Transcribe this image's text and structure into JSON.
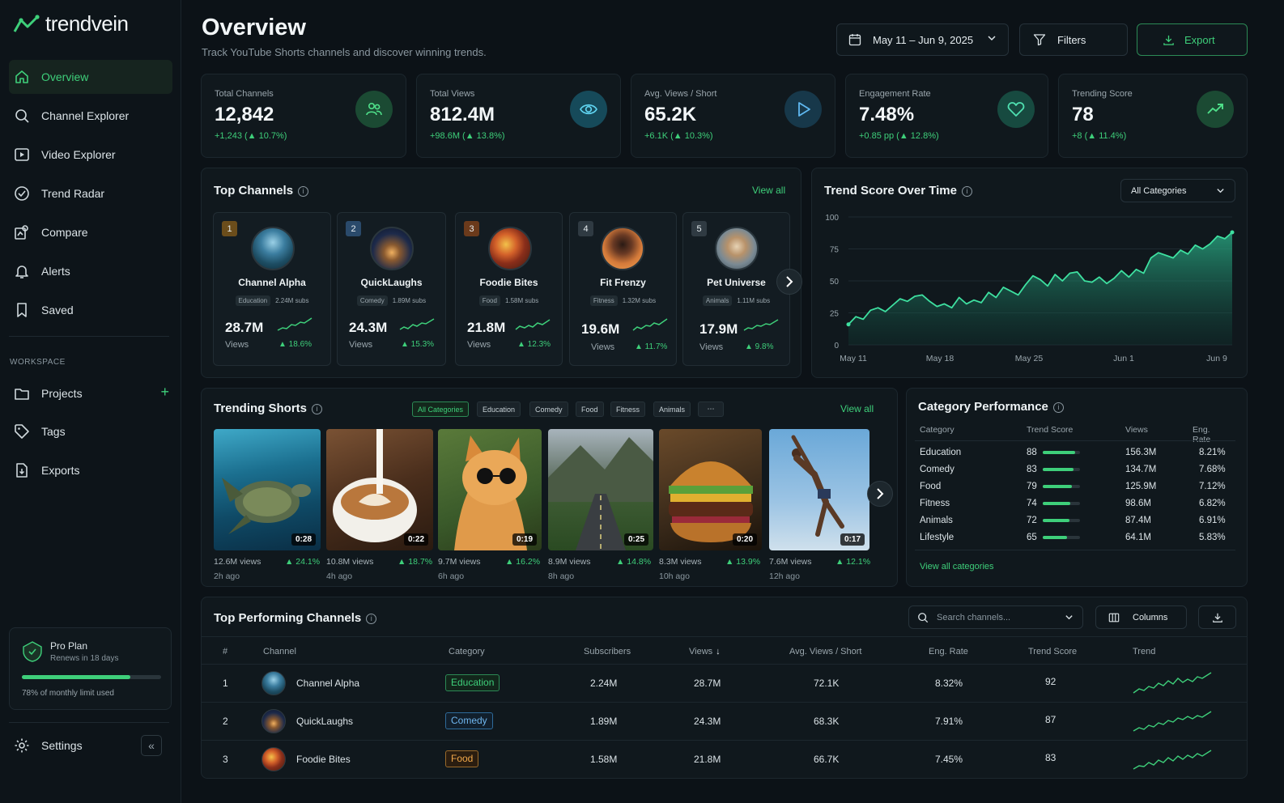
{
  "app": {
    "brand": "trendvein"
  },
  "nav": {
    "items": [
      {
        "label": "Overview"
      },
      {
        "label": "Channel Explorer"
      },
      {
        "label": "Video Explorer"
      },
      {
        "label": "Trend Radar"
      },
      {
        "label": "Compare"
      },
      {
        "label": "Alerts"
      },
      {
        "label": "Saved"
      }
    ],
    "workspace_label": "WORKSPACE",
    "workspace_items": [
      {
        "label": "Projects"
      },
      {
        "label": "Tags"
      },
      {
        "label": "Exports"
      }
    ],
    "settings_label": "Settings"
  },
  "plan": {
    "name": "Pro Plan",
    "renews": "Renews in 18 days",
    "usage_text": "78% of monthly limit used",
    "usage_fraction": 0.78
  },
  "header": {
    "title": "Overview",
    "subtitle": "Track YouTube Shorts channels and discover winning trends.",
    "date_range": "May 11 – Jun 9, 2025",
    "filters_label": "Filters",
    "export_label": "Export"
  },
  "stats": [
    {
      "label": "Total Channels",
      "value": "12,842",
      "delta": "+1,243 (▲ 10.7%)",
      "icon": "users-icon"
    },
    {
      "label": "Total Views",
      "value": "812.4M",
      "delta": "+98.6M (▲ 13.8%)",
      "icon": "eye-icon"
    },
    {
      "label": "Avg. Views / Short",
      "value": "65.2K",
      "delta": "+6.1K (▲ 10.3%)",
      "icon": "play-icon"
    },
    {
      "label": "Engagement Rate",
      "value": "7.48%",
      "delta": "+0.85 pp (▲ 12.8%)",
      "icon": "heart-icon"
    },
    {
      "label": "Trending Score",
      "value": "78",
      "delta": "+8 (▲ 11.4%)",
      "icon": "trending-up-icon"
    }
  ],
  "top_channels": {
    "title": "Top Channels",
    "view_all": "View all",
    "channels": [
      {
        "rank": "1",
        "name": "Channel Alpha",
        "category": "Education",
        "subs": "2.24M subs",
        "views": "28.7M",
        "views_label": "Views",
        "growth": "▲ 18.6%"
      },
      {
        "rank": "2",
        "name": "QuickLaughs",
        "category": "Comedy",
        "subs": "1.89M subs",
        "views": "24.3M",
        "views_label": "Views",
        "growth": "▲ 15.3%"
      },
      {
        "rank": "3",
        "name": "Foodie Bites",
        "category": "Food",
        "subs": "1.58M subs",
        "views": "21.8M",
        "views_label": "Views",
        "growth": "▲ 12.3%"
      },
      {
        "rank": "4",
        "name": "Fit Frenzy",
        "category": "Fitness",
        "subs": "1.32M subs",
        "views": "19.6M",
        "views_label": "Views",
        "growth": "▲ 11.7%"
      },
      {
        "rank": "5",
        "name": "Pet Universe",
        "category": "Animals",
        "subs": "1.11M subs",
        "views": "17.9M",
        "views_label": "Views",
        "growth": "▲ 9.8%"
      }
    ]
  },
  "trend_chart": {
    "title": "Trend Score Over Time",
    "dropdown": "All Categories"
  },
  "chart_data": {
    "type": "area",
    "title": "Trend Score Over Time",
    "x_ticks": [
      "May 11",
      "May 18",
      "May 25",
      "Jun 1",
      "Jun 9"
    ],
    "y_ticks": [
      "0",
      "25",
      "50",
      "75",
      "100"
    ],
    "ylim": [
      0,
      100
    ],
    "grid": true,
    "values": [
      16,
      22,
      20,
      27,
      29,
      26,
      31,
      36,
      34,
      38,
      39,
      34,
      30,
      32,
      29,
      37,
      32,
      35,
      33,
      41,
      37,
      45,
      42,
      39,
      47,
      54,
      51,
      46,
      55,
      50,
      56,
      57,
      50,
      49,
      53,
      48,
      52,
      58,
      53,
      59,
      56,
      68,
      72,
      70,
      68,
      74,
      71,
      78,
      75,
      79,
      85,
      83,
      88
    ]
  },
  "trending_shorts": {
    "title": "Trending Shorts",
    "view_all": "View all",
    "filters": [
      "All Categories",
      "Education",
      "Comedy",
      "Food",
      "Fitness",
      "Animals",
      "⋯"
    ],
    "items": [
      {
        "duration": "0:28",
        "views": "12.6M views",
        "growth": "▲ 24.1%",
        "age": "2h ago"
      },
      {
        "duration": "0:22",
        "views": "10.8M views",
        "growth": "▲ 18.7%",
        "age": "4h ago"
      },
      {
        "duration": "0:19",
        "views": "9.7M views",
        "growth": "▲ 16.2%",
        "age": "6h ago"
      },
      {
        "duration": "0:25",
        "views": "8.9M views",
        "growth": "▲ 14.8%",
        "age": "8h ago"
      },
      {
        "duration": "0:20",
        "views": "8.3M views",
        "growth": "▲ 13.9%",
        "age": "10h ago"
      },
      {
        "duration": "0:17",
        "views": "7.6M views",
        "growth": "▲ 12.1%",
        "age": "12h ago"
      }
    ]
  },
  "category_performance": {
    "title": "Category Performance",
    "headers": [
      "Category",
      "Trend Score",
      "Views",
      "Eng. Rate"
    ],
    "rows": [
      {
        "category": "Education",
        "score": "88",
        "score_value": 88,
        "views": "156.3M",
        "rate": "8.21%"
      },
      {
        "category": "Comedy",
        "score": "83",
        "score_value": 83,
        "views": "134.7M",
        "rate": "7.68%"
      },
      {
        "category": "Food",
        "score": "79",
        "score_value": 79,
        "views": "125.9M",
        "rate": "7.12%"
      },
      {
        "category": "Fitness",
        "score": "74",
        "score_value": 74,
        "views": "98.6M",
        "rate": "6.82%"
      },
      {
        "category": "Animals",
        "score": "72",
        "score_value": 72,
        "views": "87.4M",
        "rate": "6.91%"
      },
      {
        "category": "Lifestyle",
        "score": "65",
        "score_value": 65,
        "views": "64.1M",
        "rate": "5.83%"
      }
    ],
    "view_all": "View all categories"
  },
  "performing": {
    "title": "Top Performing Channels",
    "search_placeholder": "Search channels...",
    "columns_label": "Columns",
    "headers": {
      "rank": "#",
      "channel": "Channel",
      "category": "Category",
      "subscribers": "Subscribers",
      "views": "Views",
      "avg": "Avg. Views / Short",
      "eng": "Eng. Rate",
      "score": "Trend Score",
      "trend": "Trend"
    },
    "rows": [
      {
        "rank": "1",
        "channel": "Channel Alpha",
        "category": "Education",
        "subscribers": "2.24M",
        "views": "28.7M",
        "avg": "72.1K",
        "eng": "8.32%",
        "score": "92"
      },
      {
        "rank": "2",
        "channel": "QuickLaughs",
        "category": "Comedy",
        "subscribers": "1.89M",
        "views": "24.3M",
        "avg": "68.3K",
        "eng": "7.91%",
        "score": "87"
      },
      {
        "rank": "3",
        "channel": "Foodie Bites",
        "category": "Food",
        "subscribers": "1.58M",
        "views": "21.8M",
        "avg": "66.7K",
        "eng": "7.45%",
        "score": "83"
      }
    ]
  },
  "colors": {
    "accent": "#3ecf7a",
    "background": "#0c1217",
    "card": "#10181d"
  }
}
